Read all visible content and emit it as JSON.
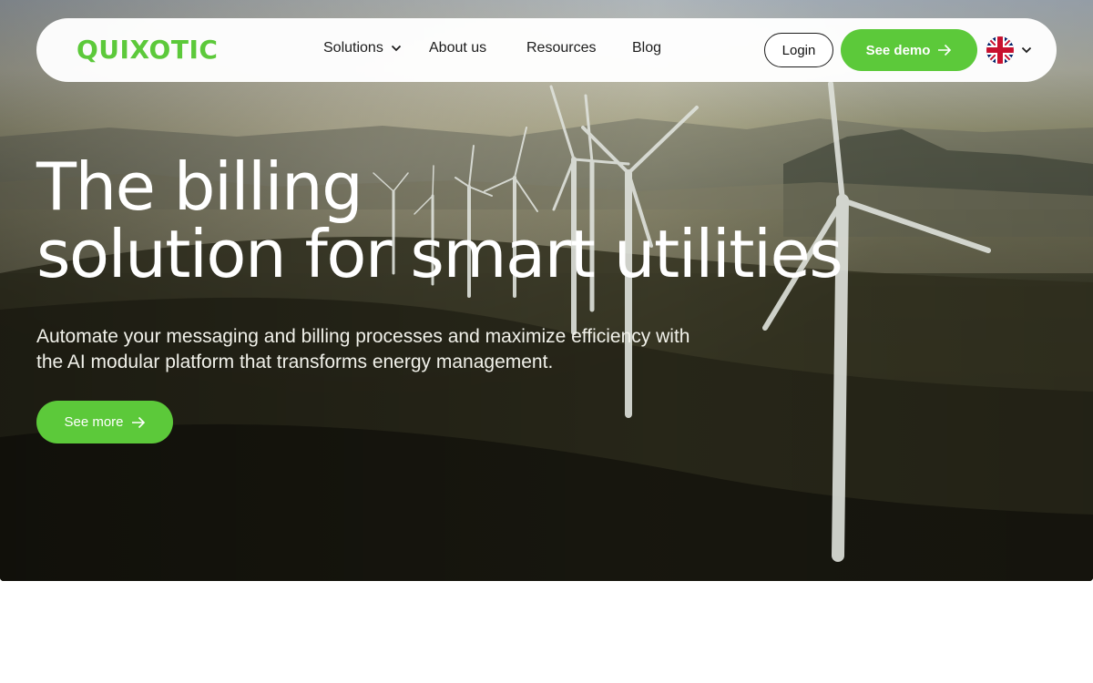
{
  "brand": {
    "name": "QUIXOTIC",
    "accent_color": "#5cc93a"
  },
  "nav": {
    "items": [
      {
        "label": "Solutions",
        "has_dropdown": true
      },
      {
        "label": "About us",
        "has_dropdown": false
      },
      {
        "label": "Resources",
        "has_dropdown": false
      },
      {
        "label": "Blog",
        "has_dropdown": false
      }
    ],
    "login_label": "Login",
    "demo_label": "See demo",
    "demo_icon": "arrow-right-icon",
    "language_icon": "uk-flag-icon",
    "language_dropdown_icon": "chevron-down-icon"
  },
  "hero": {
    "title_line1": "The billing",
    "title_line2": "solution for smart utilities",
    "subtitle": "Automate your messaging and billing processes and maximize efficiency with the AI modular platform that transforms energy management.",
    "cta_label": "See more",
    "cta_icon": "arrow-right-icon",
    "background": "wind-turbines-landscape-image"
  }
}
